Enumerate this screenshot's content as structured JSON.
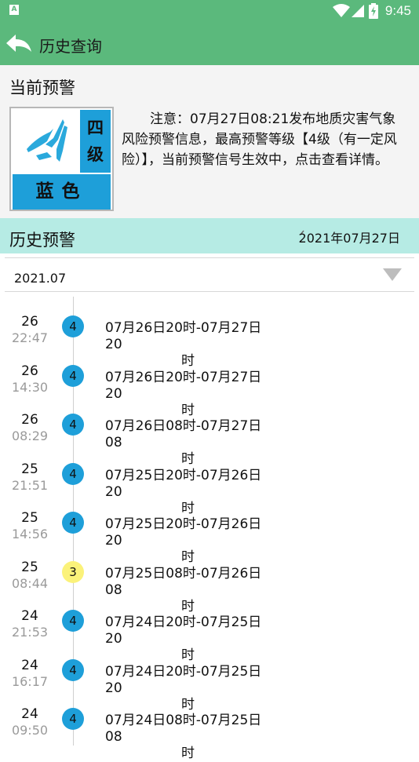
{
  "status_bar": {
    "time": "9:45",
    "app_icon_letter": "A"
  },
  "app_bar": {
    "title": "历史查询"
  },
  "current": {
    "section_title": "当前预警",
    "badge": {
      "level_line1": "四",
      "level_line2": "级",
      "color_text": "蓝色"
    },
    "notice": "注意：07月27日08:21发布地质灾害气象风险预警信息，最高预警等级【4级（有一定风险）】，当前预警信号生效中，点击查看详情。"
  },
  "history": {
    "title": "历史预警",
    "date": "2021年07月27日",
    "month": "2021.07",
    "items": [
      {
        "day": "26",
        "time": "22:47",
        "level": "4",
        "range_line1": "07月26日20时-07月27日20",
        "range_line2": "时"
      },
      {
        "day": "26",
        "time": "14:30",
        "level": "4",
        "range_line1": "07月26日20时-07月27日20",
        "range_line2": "时"
      },
      {
        "day": "26",
        "time": "08:29",
        "level": "4",
        "range_line1": "07月26日08时-07月27日08",
        "range_line2": "时"
      },
      {
        "day": "25",
        "time": "21:51",
        "level": "4",
        "range_line1": "07月25日20时-07月26日20",
        "range_line2": "时"
      },
      {
        "day": "25",
        "time": "14:56",
        "level": "4",
        "range_line1": "07月25日20时-07月26日20",
        "range_line2": "时"
      },
      {
        "day": "25",
        "time": "08:44",
        "level": "3",
        "range_line1": "07月25日08时-07月26日08",
        "range_line2": "时"
      },
      {
        "day": "24",
        "time": "21:53",
        "level": "4",
        "range_line1": "07月24日20时-07月25日20",
        "range_line2": "时"
      },
      {
        "day": "24",
        "time": "16:17",
        "level": "4",
        "range_line1": "07月24日20时-07月25日20",
        "range_line2": "时"
      },
      {
        "day": "24",
        "time": "09:50",
        "level": "4",
        "range_line1": "07月24日08时-07月25日08",
        "range_line2": "时"
      }
    ]
  },
  "colors": {
    "app_bar": "#5bb97c",
    "history_header": "#b6ebe4",
    "level_4": "#1e9fd9",
    "level_3": "#fbf27a",
    "badge_blue": "#1e9fd9"
  }
}
